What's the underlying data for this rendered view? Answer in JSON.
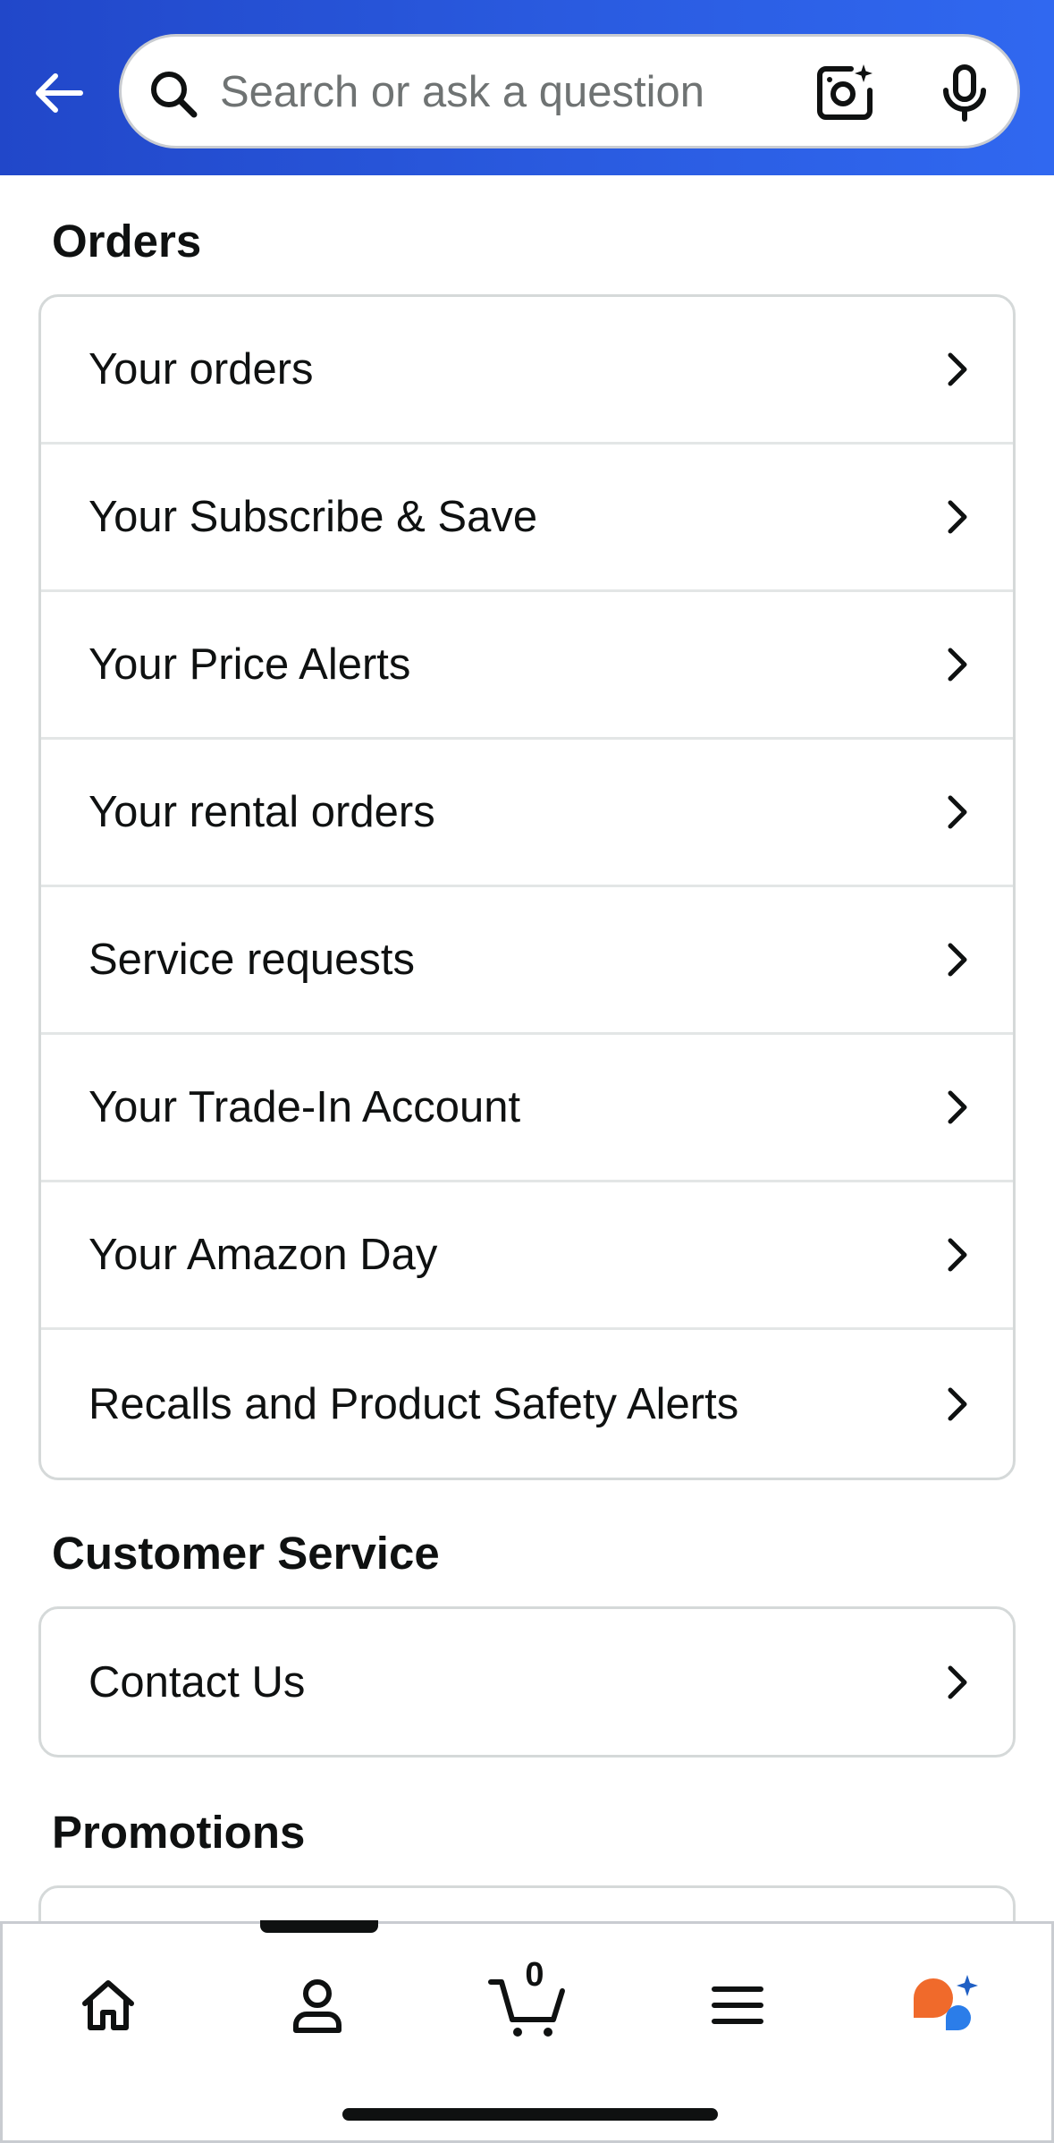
{
  "header": {
    "search": {
      "placeholder": "Search or ask a question"
    }
  },
  "sections": {
    "orders": {
      "title": "Orders",
      "items": [
        {
          "label": "Your orders"
        },
        {
          "label": "Your Subscribe & Save"
        },
        {
          "label": "Your Price Alerts"
        },
        {
          "label": "Your rental orders"
        },
        {
          "label": "Service requests"
        },
        {
          "label": "Your Trade-In Account"
        },
        {
          "label": "Your Amazon Day"
        },
        {
          "label": "Recalls and Product Safety Alerts"
        }
      ]
    },
    "customer_service": {
      "title": "Customer Service",
      "items": [
        {
          "label": "Contact Us"
        }
      ]
    },
    "promotions": {
      "title": "Promotions"
    }
  },
  "bottom_nav": {
    "active": "account",
    "items": [
      {
        "id": "home",
        "icon": "home-icon"
      },
      {
        "id": "account",
        "icon": "person-icon"
      },
      {
        "id": "cart",
        "icon": "cart-icon",
        "count": "0"
      },
      {
        "id": "menu",
        "icon": "menu-icon"
      },
      {
        "id": "rufus",
        "icon": "ai-assistant-icon"
      }
    ]
  },
  "colors": {
    "header_gradient_start": "#2147c9",
    "header_gradient_end": "#3068f0",
    "text": "#0f1111",
    "placeholder": "#6f7373",
    "border": "#d5d9d9",
    "assistant_orange": "#f06a2b",
    "assistant_blue": "#2b7de9",
    "assistant_sparkle": "#1f5fc4"
  }
}
